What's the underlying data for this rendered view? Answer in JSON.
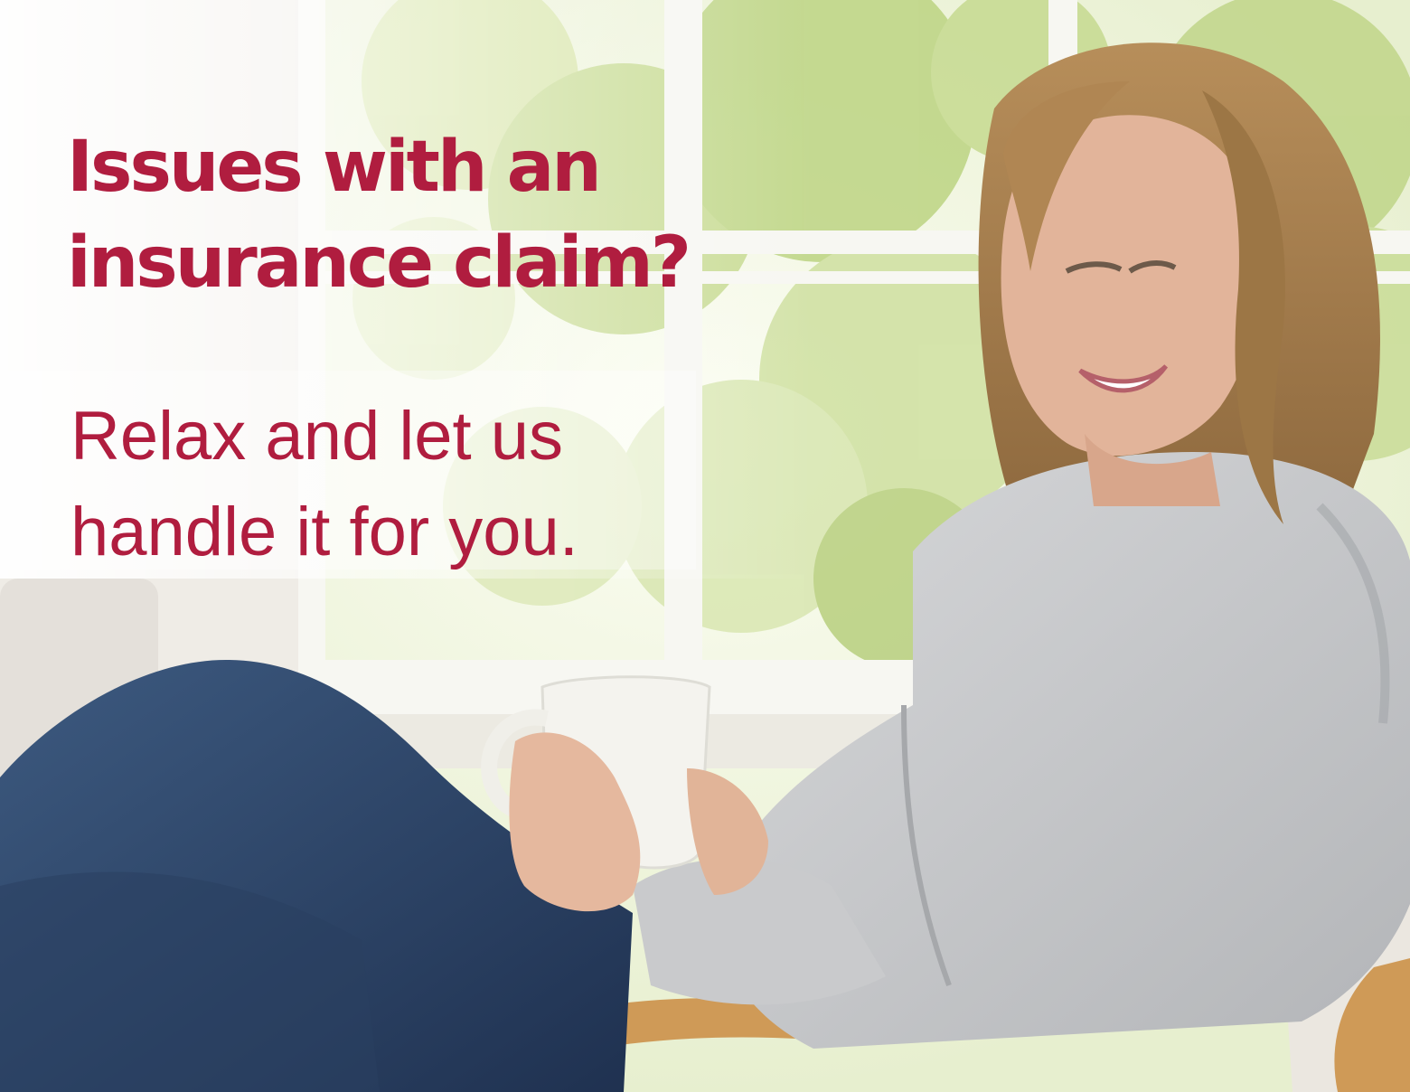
{
  "ad": {
    "headline": {
      "line1": "Issues with an",
      "line2": "insurance claim?"
    },
    "subhead": {
      "line1": "Relax and let us",
      "line2": "handle it for you."
    }
  },
  "colors": {
    "brand": "#b01d3f",
    "window_frame": "#f7f7f2",
    "foliage_light": "#dfeab6",
    "foliage_mid": "#b7cf7a",
    "sweater": "#c9cacc",
    "jeans": "#2e4566",
    "hair": "#a9814f",
    "skin": "#e2b49a",
    "chair_wood": "#cf9a57",
    "mug": "#f4f3ee"
  },
  "image": {
    "subject": "smiling-woman-with-mug-in-chair"
  }
}
